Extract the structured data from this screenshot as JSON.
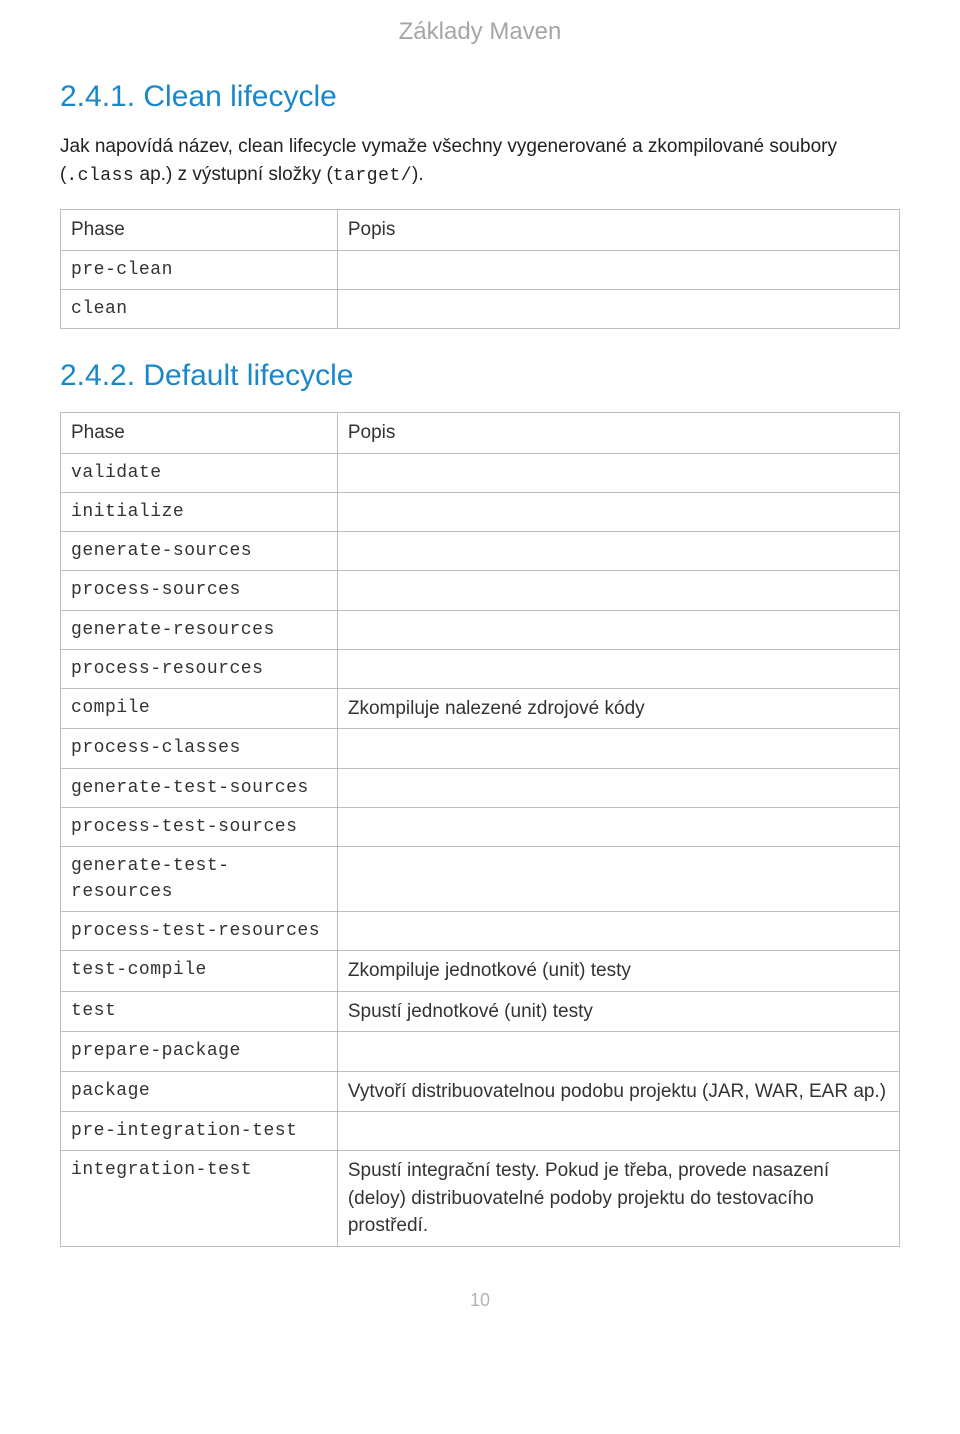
{
  "header": "Základy Maven",
  "section1": {
    "heading": "2.4.1. Clean lifecycle",
    "para_parts": {
      "p1": "Jak napovídá název, clean lifecycle vymaže všechny vygenerované a zkompilované soubory (",
      "c1": ".class",
      "p2": " ap.) z výstupní složky (",
      "c2": "target/",
      "p3": ")."
    },
    "table": {
      "headers": [
        "Phase",
        "Popis"
      ],
      "rows": [
        {
          "phase": "pre-clean",
          "popis": ""
        },
        {
          "phase": "clean",
          "popis": ""
        }
      ]
    }
  },
  "section2": {
    "heading": "2.4.2. Default lifecycle",
    "table": {
      "headers": [
        "Phase",
        "Popis"
      ],
      "rows": [
        {
          "phase": "validate",
          "popis": ""
        },
        {
          "phase": "initialize",
          "popis": ""
        },
        {
          "phase": "generate-sources",
          "popis": ""
        },
        {
          "phase": "process-sources",
          "popis": ""
        },
        {
          "phase": "generate-resources",
          "popis": ""
        },
        {
          "phase": "process-resources",
          "popis": ""
        },
        {
          "phase": "compile",
          "popis": "Zkompiluje nalezené zdrojové kódy"
        },
        {
          "phase": "process-classes",
          "popis": ""
        },
        {
          "phase": "generate-test-sources",
          "popis": ""
        },
        {
          "phase": "process-test-sources",
          "popis": ""
        },
        {
          "phase": "generate-test-resources",
          "popis": ""
        },
        {
          "phase": "process-test-resources",
          "popis": ""
        },
        {
          "phase": "test-compile",
          "popis": "Zkompiluje jednotkové (unit) testy"
        },
        {
          "phase": "test",
          "popis": "Spustí jednotkové (unit) testy"
        },
        {
          "phase": "prepare-package",
          "popis": ""
        },
        {
          "phase": "package",
          "popis": "Vytvoří distribuovatelnou podobu projektu (JAR, WAR, EAR ap.)"
        },
        {
          "phase": "pre-integration-test",
          "popis": ""
        },
        {
          "phase": "integration-test",
          "popis": "Spustí integrační testy. Pokud je třeba, provede nasazení (deloy) distribuovatelné podoby projektu do testovacího prostředí."
        }
      ]
    }
  },
  "page_number": "10"
}
